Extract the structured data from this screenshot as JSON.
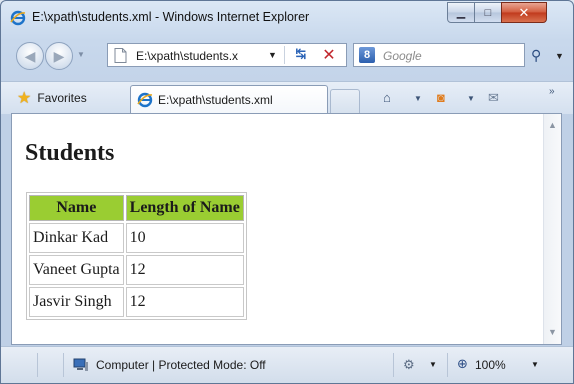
{
  "window": {
    "title": "E:\\xpath\\students.xml - Windows Internet Explorer",
    "minimize_glyph": "▁",
    "maximize_glyph": "□",
    "close_glyph": "✕"
  },
  "nav": {
    "back_glyph": "◀",
    "forward_glyph": "▶",
    "dropdown_glyph": "▼",
    "address": "E:\\xpath\\students.x",
    "address_dropdown_glyph": "▼",
    "refresh_glyph": "↹",
    "stop_glyph": "✕",
    "search_engine_letter": "8",
    "search_placeholder": "Google",
    "search_go_glyph": "⚲",
    "search_dropdown_glyph": "▼"
  },
  "favorites_bar": {
    "favorites_label": "Favorites",
    "star_glyph": "★",
    "tab_label": "E:\\xpath\\students.xml",
    "home_glyph": "⌂",
    "feeds_glyph": "◙",
    "mail_glyph": "✉",
    "dropdown_glyph": "▼",
    "more_glyph": "»"
  },
  "page": {
    "heading": "Students",
    "table": {
      "headers": [
        "Name",
        "Length of Name"
      ],
      "rows": [
        {
          "name": "Dinkar Kad",
          "length": "10"
        },
        {
          "name": "Vaneet Gupta",
          "length": "12"
        },
        {
          "name": "Jasvir Singh",
          "length": "12"
        }
      ]
    },
    "header_color": "#9acd32"
  },
  "scrollbar": {
    "up_glyph": "▲",
    "down_glyph": "▼"
  },
  "status": {
    "zone_text": "Computer | Protected Mode: Off",
    "lock_glyph": "⚙",
    "zoom_glyph": "⊕",
    "zoom_text": "100%",
    "dropdown_glyph": "▼"
  },
  "icons": {
    "title_icon": "ie-logo-icon",
    "address_icon": "document-icon",
    "search_icon": "google-icon",
    "favorites_icon": "star-icon",
    "zone_icon": "computer-icon"
  }
}
